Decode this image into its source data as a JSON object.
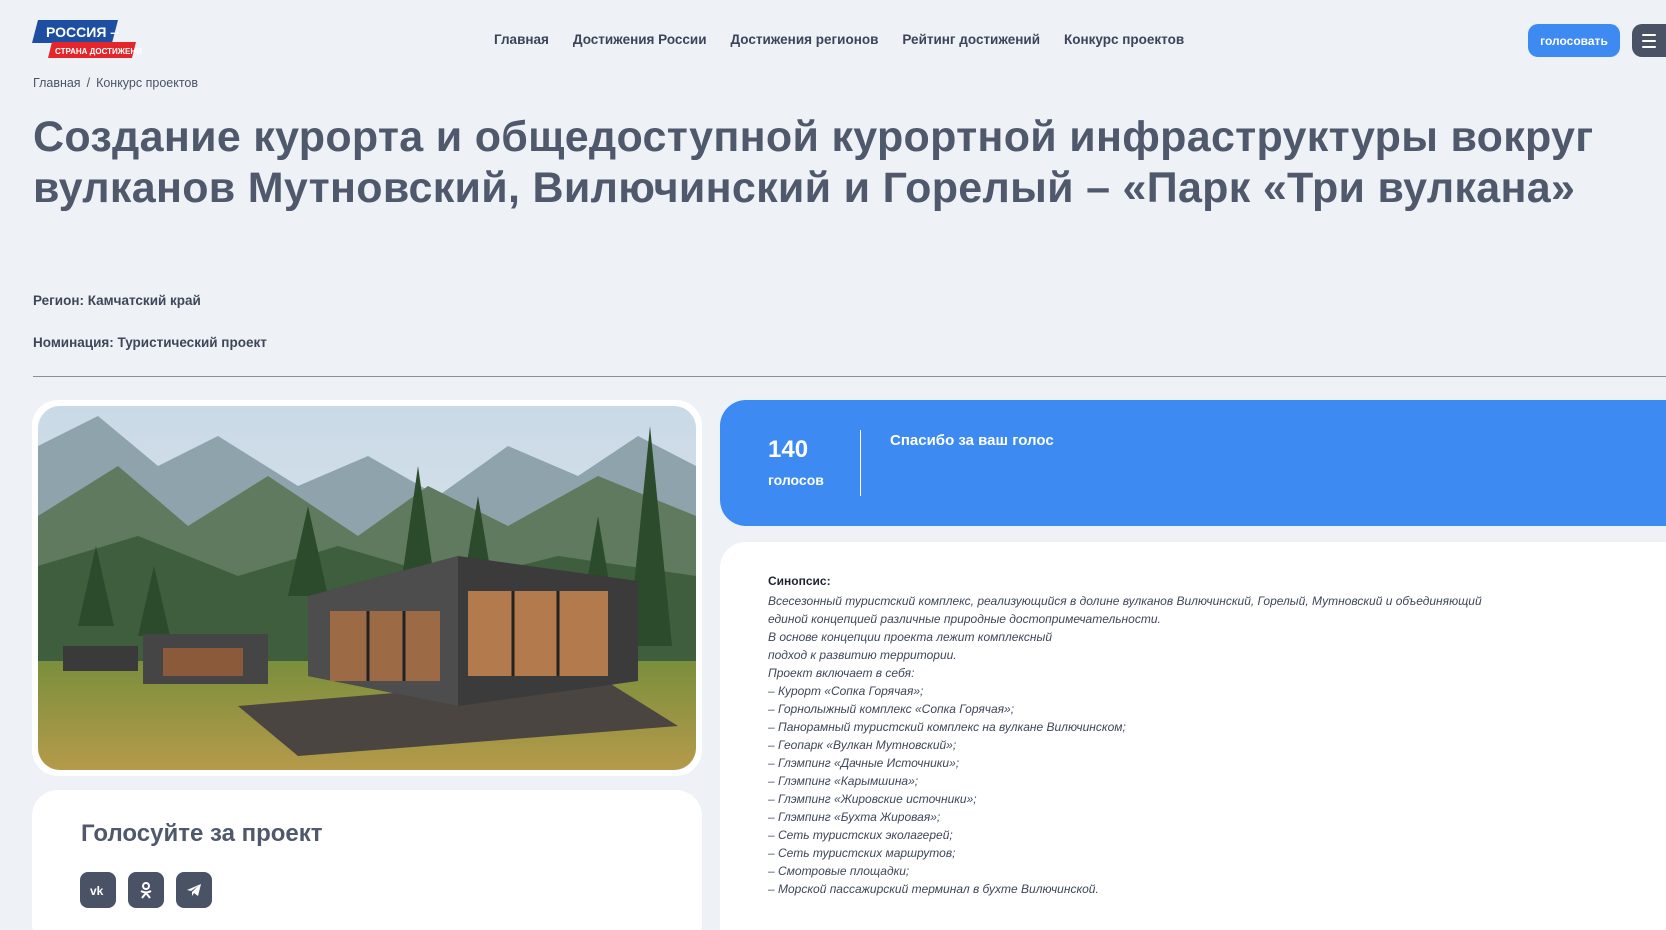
{
  "header": {
    "logo": {
      "line1": "РОССИЯ –",
      "line2": "СТРАНА ДОСТИЖЕНИЙ"
    },
    "nav": [
      "Главная",
      "Достижения России",
      "Достижения регионов",
      "Рейтинг достижений",
      "Конкурс проектов"
    ],
    "vote_button": "голосовать",
    "menu_icon": "hamburger-icon"
  },
  "breadcrumb": {
    "home": "Главная",
    "separator": "/",
    "current": "Конкурс проектов"
  },
  "project": {
    "title": "Создание курорта и общедоступной курортной инфраструктуры вокруг вулканов Мутновский, Вилючинский и Горелый – «Парк «Три вулкана»",
    "region": "Регион: Камчатский край",
    "nomination": "Номинация: Туристический проект"
  },
  "votes": {
    "count": "140",
    "label": "голосов",
    "message": "Спасибо за ваш голос"
  },
  "share": {
    "title": "Голосуйте за проект",
    "icons": [
      "vk-icon",
      "odnoklassniki-icon",
      "telegram-icon"
    ]
  },
  "synopsis": {
    "heading": "Синопсис:",
    "lines": [
      "Всесезонный туристский комплекс, реализующийся в долине вулканов Вилючинский, Горелый, Мутновский и объединяющий",
      "единой концепцией различные природные достопримечательности.",
      "В основе концепции проекта лежит комплексный",
      "подход к развитию территории.",
      "Проект включает в себя:",
      "– Курорт «Сопка Горячая»;",
      "– Горнолыжный комплекс «Сопка Горячая»;",
      "– Панорамный туристский комплекс на вулкане Вилючинском;",
      "– Геопарк «Вулкан Мутновский»;",
      "– Глэмпинг «Дачные Источники»;",
      "– Глэмпинг «Карымшина»;",
      "– Глэмпинг «Жировские источники»;",
      "– Глэмпинг «Бухта Жировая»;",
      "– Сеть туристских эколагерей;",
      "– Сеть туристских маршрутов;",
      "– Смотровые площадки;",
      "– Морской пассажирский терминал в бухте Вилючинской."
    ]
  },
  "colors": {
    "accent": "#3d8bf2",
    "text": "#4f596b",
    "background": "#eef1f6",
    "logo_red": "#e4262b",
    "logo_blue": "#1d4ea1"
  }
}
